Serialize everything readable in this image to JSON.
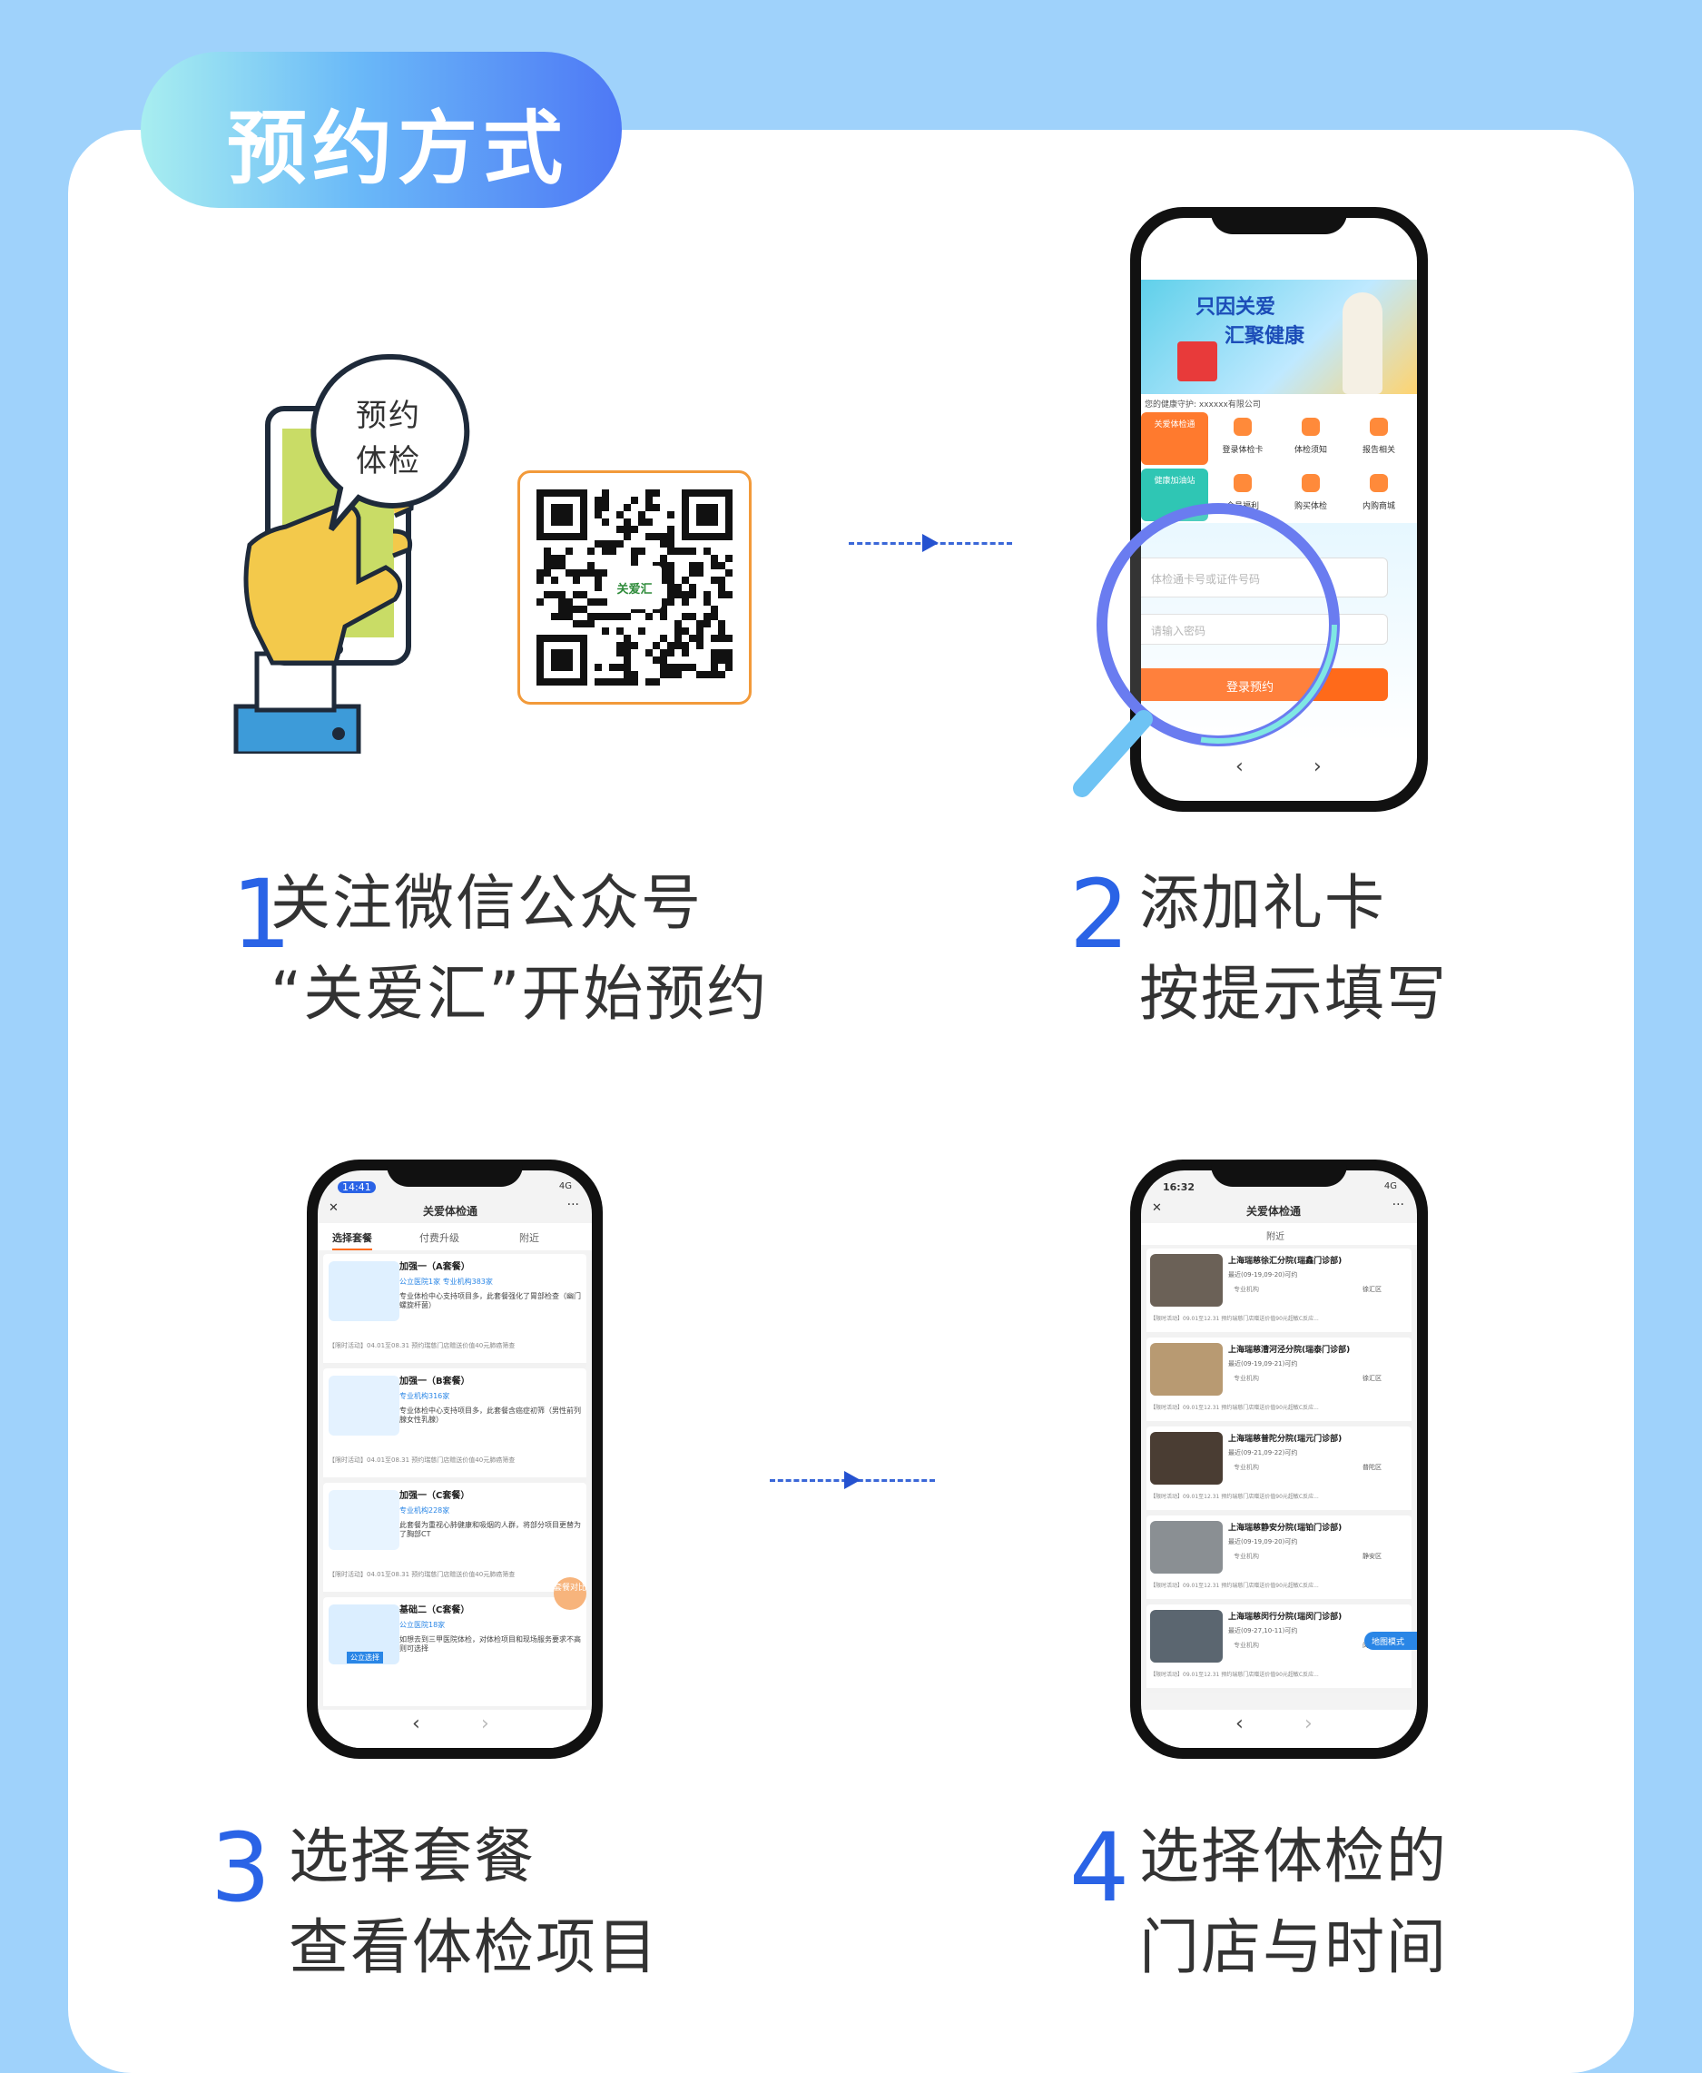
{
  "header": {
    "title": "预约方式"
  },
  "steps": [
    {
      "num": "1",
      "line1": "关注微信公众号",
      "line2": "“关爱汇”开始预约"
    },
    {
      "num": "2",
      "line1": "添加礼卡",
      "line2": "按提示填写"
    },
    {
      "num": "3",
      "line1": "选择套餐",
      "line2": "查看体检项目"
    },
    {
      "num": "4",
      "line1": "选择体检的",
      "line2": "门店与时间"
    }
  ],
  "bubble": {
    "line1": "预约",
    "line2": "体检"
  },
  "qr": {
    "logo_text": "关爱汇"
  },
  "phone2": {
    "banner_line1": "只因关爱",
    "banner_line2": "汇聚健康",
    "company": "您的健康守护: xxxxxx有限公司",
    "menu_row1": [
      "关爱体检通",
      "登录体检卡",
      "体检须知",
      "报告相关"
    ],
    "menu_row2": [
      "健康加油站",
      "会员福利",
      "购买体检",
      "内购商城"
    ],
    "card_placeholder": "体检通卡号或证件号码",
    "password_placeholder": "请输入密码",
    "login_button": "登录预约"
  },
  "phone3": {
    "time": "14:41",
    "signal": "4G",
    "app_title": "关爱体检通",
    "tabs": [
      "选择套餐",
      "付费升级",
      "附近"
    ],
    "packages": [
      {
        "name": "加强一（A套餐）",
        "tags": "公立医院1家  专业机构383家",
        "desc": "专业体检中心支持项目多，此套餐强化了胃部检查（幽门螺旋杆菌）",
        "promo": "【限时活动】04.01至08.31 预约瑞慈门店赠送价值40元肺癌筛查"
      },
      {
        "name": "加强一（B套餐）",
        "tags": "专业机构316家",
        "desc": "专业体检中心支持项目多，此套餐含癌症初筛（男性前列腺女性乳腺）",
        "promo": "【限时活动】04.01至08.31 预约瑞慈门店赠送价值40元肺癌筛查"
      },
      {
        "name": "加强一（C套餐）",
        "tags": "专业机构228家",
        "desc": "此套餐为重视心肺健康和吸烟的人群，将部分项目更替为了胸部CT",
        "promo": "【限时活动】04.01至08.31 预约瑞慈门店赠送价值40元肺癌筛查"
      },
      {
        "name": "基础二（C套餐）",
        "tags": "公立医院18家",
        "desc": "如想去到三甲医院体检，对体检项目和现场服务要求不高则可选择",
        "promo": ""
      }
    ],
    "compare_badge": "套餐对比",
    "public_select": "公立选择"
  },
  "phone4": {
    "time": "16:32",
    "signal": "4G",
    "app_title": "关爱体检通",
    "filter": "附近",
    "map_mode": "地图模式",
    "stores": [
      {
        "name": "上海瑞慈徐汇分院(瑞鑫门诊部)",
        "date": "最近(09-19,09-20)可约",
        "tag": "专业机构",
        "district": "徐汇区",
        "promo": "【限时活动】09.01至12.31 预约瑞慈门店赠送价值90元超敏C反应..."
      },
      {
        "name": "上海瑞慈漕河泾分院(瑞泰门诊部)",
        "date": "最近(09-19,09-21)可约",
        "tag": "专业机构",
        "district": "徐汇区",
        "promo": "【限时活动】09.01至12.31 预约瑞慈门店赠送价值90元超敏C反应..."
      },
      {
        "name": "上海瑞慈普陀分院(瑞元门诊部)",
        "date": "最近(09-21,09-22)可约",
        "tag": "专业机构",
        "district": "普陀区",
        "promo": "【限时活动】09.01至12.31 预约瑞慈门店赠送价值90元超敏C反应..."
      },
      {
        "name": "上海瑞慈静安分院(瑞铂门诊部)",
        "date": "最近(09-19,09-20)可约",
        "tag": "专业机构",
        "district": "静安区",
        "promo": "【限时活动】09.01至12.31 预约瑞慈门店赠送价值90元超敏C反应..."
      },
      {
        "name": "上海瑞慈闵行分院(瑞闵门诊部)",
        "date": "最近(09-27,10-11)可约",
        "tag": "专业机构",
        "district": "闵行区",
        "promo": "【限时活动】09.01至12.31 预约瑞慈门店赠送价值90元超敏C反应..."
      }
    ]
  },
  "nav": {
    "back": "‹",
    "forward": "›"
  },
  "colors": {
    "accent_blue": "#2a63e6",
    "orange": "#ff6a1a",
    "phone_green": "#c9dc66"
  }
}
